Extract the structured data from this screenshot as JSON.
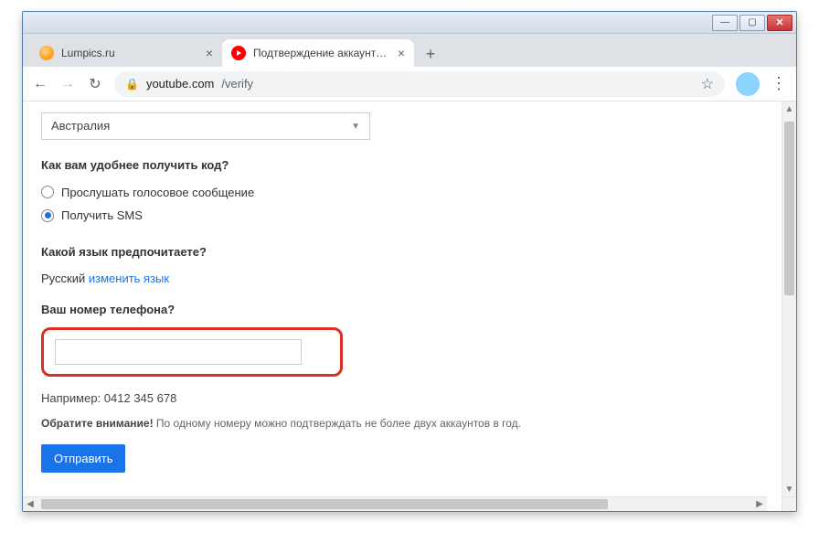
{
  "window": {
    "minimize": "—",
    "maximize": "▢",
    "close": "✕"
  },
  "tabs": [
    {
      "title": "Lumpics.ru"
    },
    {
      "title": "Подтверждение аккаунта - You"
    }
  ],
  "newtab": "+",
  "nav": {
    "back": "←",
    "forward": "→",
    "reload": "↻",
    "menu": "⋮"
  },
  "omnibox": {
    "lock": "🔒",
    "domain": "youtube.com",
    "path": "/verify",
    "star": "☆"
  },
  "form": {
    "country_selected": "Австралия",
    "q_code_delivery": "Как вам удобнее получить код?",
    "radio_voice": "Прослушать голосовое сообщение",
    "radio_sms": "Получить SMS",
    "q_language": "Какой язык предпочитаете?",
    "language_value": "Русский",
    "change_language_link": "изменить язык",
    "q_phone": "Ваш номер телефона?",
    "phone_value": "",
    "example_prefix": "Например: ",
    "example_number": "0412 345 678",
    "note_bold": "Обратите внимание!",
    "note_rest": " По одному номеру можно подтверждать не более двух аккаунтов в год.",
    "submit": "Отправить"
  }
}
